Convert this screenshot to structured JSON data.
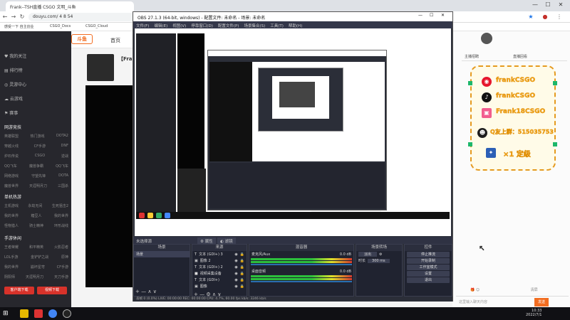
{
  "browser": {
    "tab_label": "Frank--TSH直播 CSGO 文明_斗鱼",
    "url": "douyu.com/ 4 8 54",
    "bookmarks": [
      "感受一下 自主创业",
      "CSGO_Docs",
      "CSGO_Cloud"
    ]
  },
  "douyu": {
    "logo": "斗鱼",
    "nav": "首页",
    "sidebar": {
      "items": [
        "我的关注",
        "排行榜",
        "灵游中心",
        "云游戏",
        "赛事"
      ],
      "section_game": "网游竞技",
      "games": [
        [
          "英雄联盟",
          "热门游戏",
          "DOTA2"
        ],
        [
          "穿越火线",
          "CF手游",
          "DNF"
        ],
        [
          "炉石传说",
          "CSGO",
          "逆战"
        ],
        [
          "QQ飞车",
          "魔兽争霸",
          "QQ飞车"
        ],
        [
          "网络游戏",
          "守望先锋",
          "DOTA"
        ],
        [
          "魔兽世界",
          "天涯明月刀",
          "三国杀"
        ]
      ],
      "section_single": "单机热游",
      "single": [
        [
          "主机游戏",
          "永劫无间",
          "生死狙击2"
        ],
        [
          "我的世界",
          "糖豆人",
          "我的世界"
        ],
        [
          "怪物猎人",
          "骑士精神",
          "环形战线"
        ]
      ],
      "section_mobile": "手游休闲",
      "mobile": [
        [
          "王者荣耀",
          "和平精英",
          "火影忍者"
        ],
        [
          "LOL手游",
          "金铲铲之战",
          "原神"
        ],
        [
          "我的世界",
          "崩坏星穹",
          "CF手游"
        ],
        [
          "阴阳师",
          "天涯明月刀",
          "天刀手游"
        ]
      ],
      "btn_left": "客户端下载",
      "btn_right": "视频下载"
    },
    "room_title": "【Frank】",
    "right_header": [
      "主播招聘",
      "直播回看"
    ],
    "promo_lines": [
      "frankCSGO",
      "frankCSGO",
      "Frank18CSGO",
      "Q友上群：515035753",
      "×1 定级"
    ],
    "chat_placeholder": "这里输入聊天内容",
    "send": "发送",
    "tools": "清屏"
  },
  "obs": {
    "title": "OBS 27.1.3 (64-bit, windows) - 配置文件: 未命名 - 场景: 未命名",
    "menu": [
      "文件(F)",
      "编辑(E)",
      "视图(V)",
      "停靠窗口(D)",
      "配置文件(P)",
      "场景集合(S)",
      "工具(T)",
      "帮助(H)"
    ],
    "dock_header": [
      "未选择源",
      "属性",
      "滤镜"
    ],
    "docks": {
      "scenes": "场景",
      "scene_item": "场景",
      "sources": "来源",
      "source_items": [
        "文本 (GDI+) 3",
        "图像 2",
        "文本 (GDI+) 2",
        "视频采集设备",
        "文本 (GDI+)",
        "图像"
      ],
      "mixer": "混音器",
      "mixer_items": [
        "麦克风/Aux",
        "桌面音频"
      ],
      "mixer_vol": [
        "0.0 dB",
        "0.0 dB"
      ],
      "transitions": "场景转场",
      "transition_type": "淡出",
      "duration_label": "时长",
      "duration_value": "300 ms",
      "controls": "控件",
      "control_buttons": [
        "停止推流",
        "开始录制",
        "工作室模式",
        "设置",
        "退出"
      ]
    },
    "status": "丢帧 0 (0.0%)    LIVE: 00:00:00    REC: 00:00:00    CPU: 4.7%, 60.00 fps    kb/s: 3246 kb/s"
  },
  "taskbar": {
    "time": "10:33",
    "date": "2022/7/1"
  },
  "colors": {
    "douyu_orange": "#f26d21",
    "promo_gold": "#f0a31c",
    "obs_bg": "#2b2e38"
  }
}
